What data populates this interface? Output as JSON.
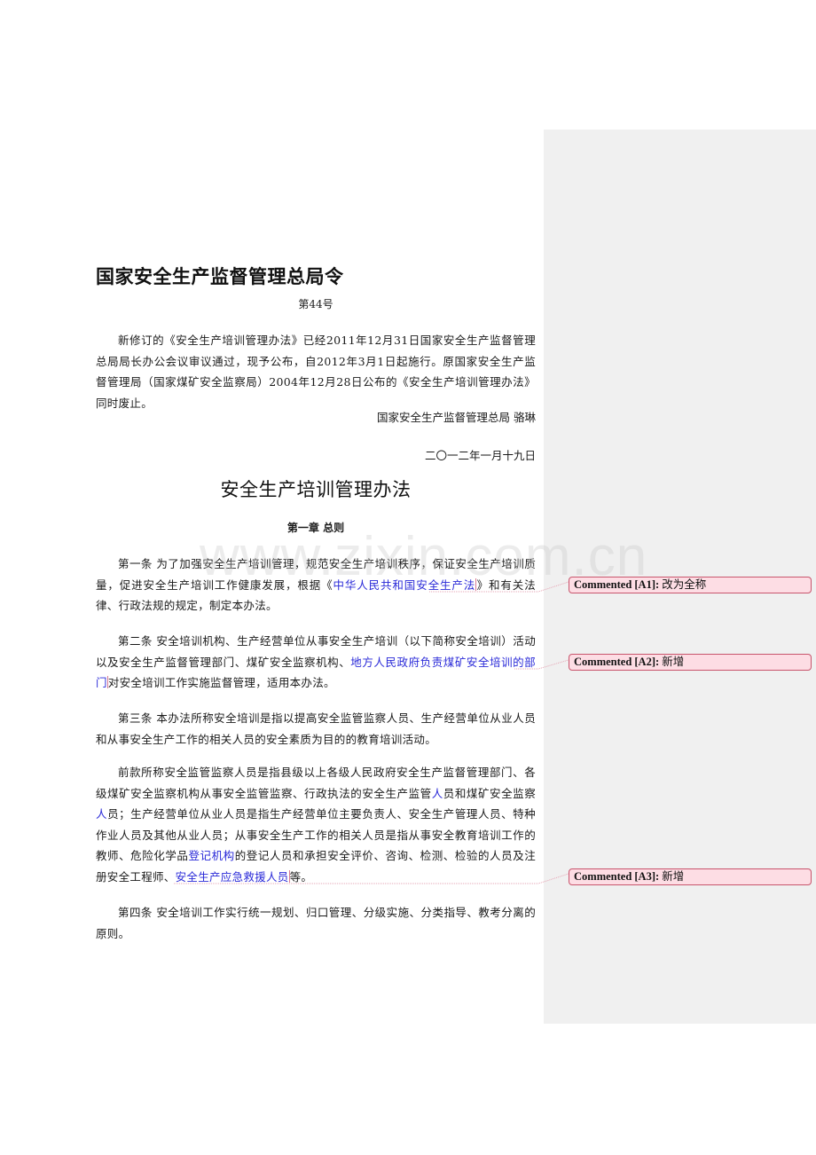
{
  "document": {
    "header_title": "国家安全生产监督管理总局令",
    "order_number": "第44号",
    "preamble": "新修订的《安全生产培训管理办法》已经2011年12月31日国家安全生产监督管理总局局长办公会议审议通过，现予公布，自2012年3月1日起施行。原国家安全生产监督管理局（国家煤矿安全监察局）2004年12月28日公布的《安全生产培训管理办法》同时废止。",
    "signature": "国家安全生产监督管理总局 骆琳",
    "date": "二〇一二年一月十九日",
    "regulation_title": "安全生产培训管理办法",
    "chapter_heading": "第一章  总则",
    "article1": {
      "before": "第一条  为了加强安全生产培训管理，规范安全生产培训秩序，保证安全生产培训质量，促进安全生产培训工作健康发展，根据《",
      "inserted": "中华人民共和国安全生产法",
      "after": "》和有关法律、行政法规的规定，制定本办法。"
    },
    "article2": {
      "before": "第二条  安全培训机构、生产经营单位从事安全生产培训（以下简称安全培训）活动以及安全生产监督管理部门、煤矿安全监察机构、",
      "inserted": "地方人民政府负责煤矿安全培训的部门",
      "after": "对安全培训工作实施监督管理，适用本办法。"
    },
    "article3": "第三条  本办法所称安全培训是指以提高安全监管监察人员、生产经营单位从业人员和从事安全生产工作的相关人员的安全素质为目的的教育培训活动。",
    "paragraph_prior": {
      "part1": "前款所称安全监管监察人员是指县级以上各级人民政府安全生产监督管理部门、各级煤矿安全监察机构从事安全监管监察、行政执法的安全生产监管",
      "ins1": "人",
      "part2": "员和煤矿安全监察",
      "ins2": "人",
      "part3": "员；生产经营单位从业人员是指生产经营单位主要负责人、安全生产管理人员、特种作业人员及其他从业人员；从事安全生产工作的相关人员是指从事安全教育培训工作的教师、危险化学品",
      "ins3": "登记机构",
      "part4": "的登记人员和承担安全评价、咨询、检测、检验的人员及注册安全工程师、",
      "ins4": "安全生产应急救援人员",
      "part5": "等。"
    },
    "article4": "第四条  安全培训工作实行统一规划、归口管理、分级实施、分类指导、教考分离的原则。"
  },
  "comments": [
    {
      "label": "Commented [A1]:",
      "text": "改为全称"
    },
    {
      "label": "Commented [A2]:",
      "text": "新增"
    },
    {
      "label": "Commented [A3]:",
      "text": "新增"
    }
  ],
  "watermark": "www.zixin.com.cn",
  "colors": {
    "inserted_text": "#2a2ad8",
    "comment_fill": "#fddde4",
    "comment_border": "#c8546c",
    "margin_pane": "#f0f0f0"
  }
}
